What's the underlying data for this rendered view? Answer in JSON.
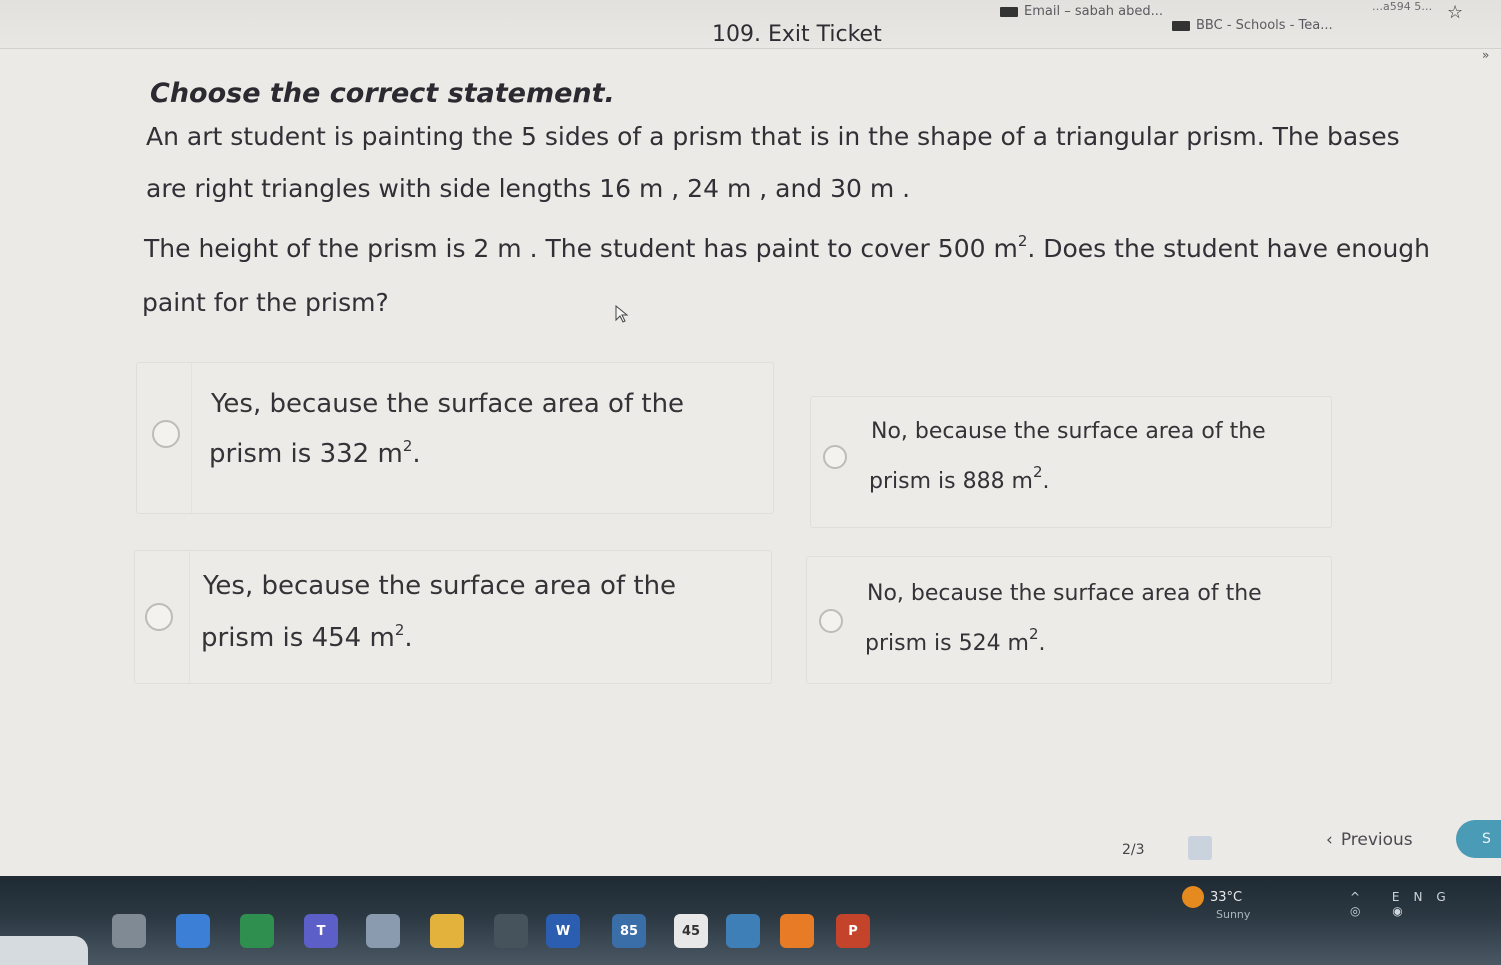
{
  "browser": {
    "bookmarks": [
      {
        "label": "Email – sabah abed..."
      },
      {
        "label": "BBC - Schools - Tea..."
      }
    ],
    "extra": "…a594 5…"
  },
  "page": {
    "title": "109. Exit Ticket",
    "prompt": "Choose the correct statement.",
    "question_lines": [
      "An art student is painting the 5 sides of a prism that is in the shape of a triangular prism. The bases",
      "are right triangles with side lengths 16 m , 24 m , and 30 m .",
      "The height of the prism is 2 m . The student has paint to cover 500 m",
      ". Does the student have enough",
      "paint for the prism?"
    ],
    "exponent": "2"
  },
  "options": [
    {
      "line1": "Yes, because the surface area of the",
      "line2": "prism is 332 m",
      "suffix": "."
    },
    {
      "line1": "No, because the surface area of the",
      "line2": "prism is 888 m",
      "suffix": "."
    },
    {
      "line1": "Yes, because the surface area of the",
      "line2": "prism is 454 m",
      "suffix": "."
    },
    {
      "line1": "No, because the surface area of the",
      "line2": "prism is 524 m",
      "suffix": "."
    }
  ],
  "navigation": {
    "page_indicator": "2/3",
    "previous_label": "Previous",
    "next_label": "S"
  },
  "taskbar": {
    "weather_temp": "33°C",
    "weather_desc": "Sunny",
    "weather_alert": "1",
    "apps": [
      {
        "icon": "file-explorer-icon",
        "color": "#7f8a95",
        "label": ""
      },
      {
        "icon": "copilot-icon",
        "color": "#3c7fd6",
        "label": ""
      },
      {
        "icon": "chrome-icon",
        "color": "#2f8f4e",
        "label": ""
      },
      {
        "icon": "teams-icon",
        "color": "#5b5fc7",
        "label": "T"
      },
      {
        "icon": "calculator-icon",
        "color": "#8a9bb0",
        "label": ""
      },
      {
        "icon": "folder-icon",
        "color": "#e3b23c",
        "label": ""
      },
      {
        "icon": "app-icon",
        "color": "#46525c",
        "label": ""
      },
      {
        "icon": "word-icon",
        "color": "#2b5eb0",
        "label": "W"
      },
      {
        "icon": "email-icon",
        "color": "#3a6ea8",
        "label": "85"
      },
      {
        "icon": "notification-icon",
        "color": "#e8e8e8",
        "label": "45"
      },
      {
        "icon": "calendar-icon",
        "color": "#3f7fb8",
        "label": ""
      },
      {
        "icon": "orange-app-icon",
        "color": "#e87b26",
        "label": ""
      },
      {
        "icon": "powerpoint-icon",
        "color": "#c4442b",
        "label": "P"
      }
    ]
  }
}
